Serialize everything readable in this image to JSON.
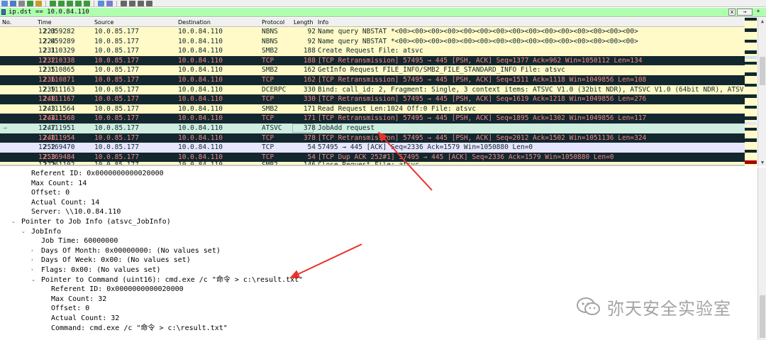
{
  "toolbar": {
    "icons": [
      "open-icon",
      "save-icon",
      "close-file-icon",
      "reload-icon",
      "find-icon",
      "go-back-icon",
      "go-forward-icon",
      "go-to-packet-icon",
      "go-first-icon",
      "go-last-icon",
      "autoscroll-icon",
      "colorize-icon",
      "zoom-in-icon",
      "zoom-out-icon",
      "normal-size-icon",
      "resize-columns-icon"
    ]
  },
  "filter": {
    "value": "ip.dst == 10.0.84.110",
    "apply_label": "→",
    "add_label": "+",
    "clear_label": "x"
  },
  "packet_list": {
    "columns": [
      "No.",
      "Time",
      "Source",
      "Destination",
      "Protocol",
      "Length",
      "Info"
    ],
    "rows": [
      {
        "no": "223",
        "time": "12.059282",
        "src": "10.0.85.177",
        "dst": "10.0.84.110",
        "proto": "NBNS",
        "len": "92",
        "info": "Name query NBSTAT *<00><00><00><00><00><00><00><00><00><00><00><00><00><00><00>",
        "style": "smb"
      },
      {
        "no": "224",
        "time": "12.059289",
        "src": "10.0.85.177",
        "dst": "10.0.84.110",
        "proto": "NBNS",
        "len": "92",
        "info": "Name query NBSTAT *<00><00><00><00><00><00><00><00><00><00><00><00><00><00><00>",
        "style": "smb"
      },
      {
        "no": "231",
        "time": "12.110329",
        "src": "10.0.85.177",
        "dst": "10.0.84.110",
        "proto": "SMB2",
        "len": "188",
        "info": "Create Request File: atsvc",
        "style": "smb"
      },
      {
        "no": "232",
        "time": "12.110338",
        "src": "10.0.85.177",
        "dst": "10.0.84.110",
        "proto": "TCP",
        "len": "188",
        "info": "[TCP Retransmission] 57495 → 445 [PSH, ACK] Seq=1377 Ack=962 Win=1050112 Len=134",
        "style": "tcpbad"
      },
      {
        "no": "235",
        "time": "12.110865",
        "src": "10.0.85.177",
        "dst": "10.0.84.110",
        "proto": "SMB2",
        "len": "162",
        "info": "GetInfo Request FILE_INFO/SMB2_FILE_STANDARD_INFO File: atsvc",
        "style": "smb"
      },
      {
        "no": "236",
        "time": "12.110871",
        "src": "10.0.85.177",
        "dst": "10.0.84.110",
        "proto": "TCP",
        "len": "162",
        "info": "[TCP Retransmission] 57495 → 445 [PSH, ACK] Seq=1511 Ack=1118 Win=1049856 Len=108",
        "style": "tcpbad"
      },
      {
        "no": "239",
        "time": "12.111163",
        "src": "10.0.85.177",
        "dst": "10.0.84.110",
        "proto": "DCERPC",
        "len": "330",
        "info": "Bind: call_id: 2, Fragment: Single, 3 context items: ATSVC V1.0 (32bit NDR), ATSVC V1.0 (64bit NDR), ATSV…",
        "style": "smb"
      },
      {
        "no": "240",
        "time": "12.111167",
        "src": "10.0.85.177",
        "dst": "10.0.84.110",
        "proto": "TCP",
        "len": "330",
        "info": "[TCP Retransmission] 57495 → 445 [PSH, ACK] Seq=1619 Ack=1218 Win=1049856 Len=276",
        "style": "tcpbad"
      },
      {
        "no": "243",
        "time": "12.111564",
        "src": "10.0.85.177",
        "dst": "10.0.84.110",
        "proto": "SMB2",
        "len": "171",
        "info": "Read Request Len:1024 Off:0 File: atsvc",
        "style": "smb"
      },
      {
        "no": "244",
        "time": "12.111568",
        "src": "10.0.85.177",
        "dst": "10.0.84.110",
        "proto": "TCP",
        "len": "171",
        "info": "[TCP Retransmission] 57495 → 445 [PSH, ACK] Seq=1895 Ack=1302 Win=1049856 Len=117",
        "style": "tcpbad"
      },
      {
        "no": "247",
        "time": "12.111951",
        "src": "10.0.85.177",
        "dst": "10.0.84.110",
        "proto": "ATSVC",
        "len": "378",
        "info": "JobAdd request",
        "style": "sel"
      },
      {
        "no": "248",
        "time": "12.111954",
        "src": "10.0.85.177",
        "dst": "10.0.84.110",
        "proto": "TCP",
        "len": "378",
        "info": "[TCP Retransmission] 57495 → 445 [PSH, ACK] Seq=2012 Ack=1502 Win=1051136 Len=324",
        "style": "tcpbad"
      },
      {
        "no": "252",
        "time": "12.169470",
        "src": "10.0.85.177",
        "dst": "10.0.84.110",
        "proto": "TCP",
        "len": "54",
        "info": "57495 → 445 [ACK] Seq=2336 Ack=1579 Win=1050880 Len=0",
        "style": "tcp"
      },
      {
        "no": "253",
        "time": "12.169484",
        "src": "10.0.85.177",
        "dst": "10.0.84.110",
        "proto": "TCP",
        "len": "54",
        "info": "[TCP Dup ACK 252#1] 57495 → 445 [ACK] Seq=2336 Ack=1579 Win=1050880 Len=0",
        "style": "tcpbad"
      },
      {
        "no": "272",
        "time": "12.261102",
        "src": "10.0.85.177",
        "dst": "10.0.84.110",
        "proto": "SMB2",
        "len": "146",
        "info": "Close Request File: atsvc",
        "style": "cut"
      }
    ],
    "selected_marker": "→"
  },
  "details": {
    "lines": [
      {
        "indent": 3,
        "tw": "",
        "text": "Referent ID: 0x0000000000020000"
      },
      {
        "indent": 3,
        "tw": "",
        "text": "Max Count: 14"
      },
      {
        "indent": 3,
        "tw": "",
        "text": "Offset: 0"
      },
      {
        "indent": 3,
        "tw": "",
        "text": "Actual Count: 14"
      },
      {
        "indent": 3,
        "tw": "",
        "text": "Server: \\\\10.0.84.110"
      },
      {
        "indent": 2,
        "tw": "v",
        "text": "Pointer to Job Info (atsvc_JobInfo)"
      },
      {
        "indent": 3,
        "tw": "v",
        "text": "JobInfo"
      },
      {
        "indent": 4,
        "tw": "",
        "text": "Job Time: 60000000"
      },
      {
        "indent": 4,
        "tw": ">",
        "text": "Days Of Month: 0x00000000: (No values set)"
      },
      {
        "indent": 4,
        "tw": ">",
        "text": "Days Of Week: 0x00: (No values set)"
      },
      {
        "indent": 4,
        "tw": ">",
        "text": "Flags: 0x00: (No values set)"
      },
      {
        "indent": 4,
        "tw": "v",
        "text": "Pointer to Command (uint16): cmd.exe /c \"命令 > c:\\result.txt\""
      },
      {
        "indent": 5,
        "tw": "",
        "text": "Referent ID: 0x0000000000020000"
      },
      {
        "indent": 5,
        "tw": "",
        "text": "Max Count: 32"
      },
      {
        "indent": 5,
        "tw": "",
        "text": "Offset: 0"
      },
      {
        "indent": 5,
        "tw": "",
        "text": "Actual Count: 32"
      },
      {
        "indent": 5,
        "tw": "",
        "text": "Command: cmd.exe /c \"命令 > c:\\result.txt\""
      }
    ]
  },
  "watermark": {
    "text": "弥天安全实验室"
  },
  "colors": {
    "smb_bg": "#fffac8",
    "tcp_bad_bg": "#12272e",
    "tcp_bad_fg": "#f78787",
    "selected_bg": "#d0eee0",
    "filter_bg": "#afffaf",
    "arrow": "#e8332a"
  }
}
